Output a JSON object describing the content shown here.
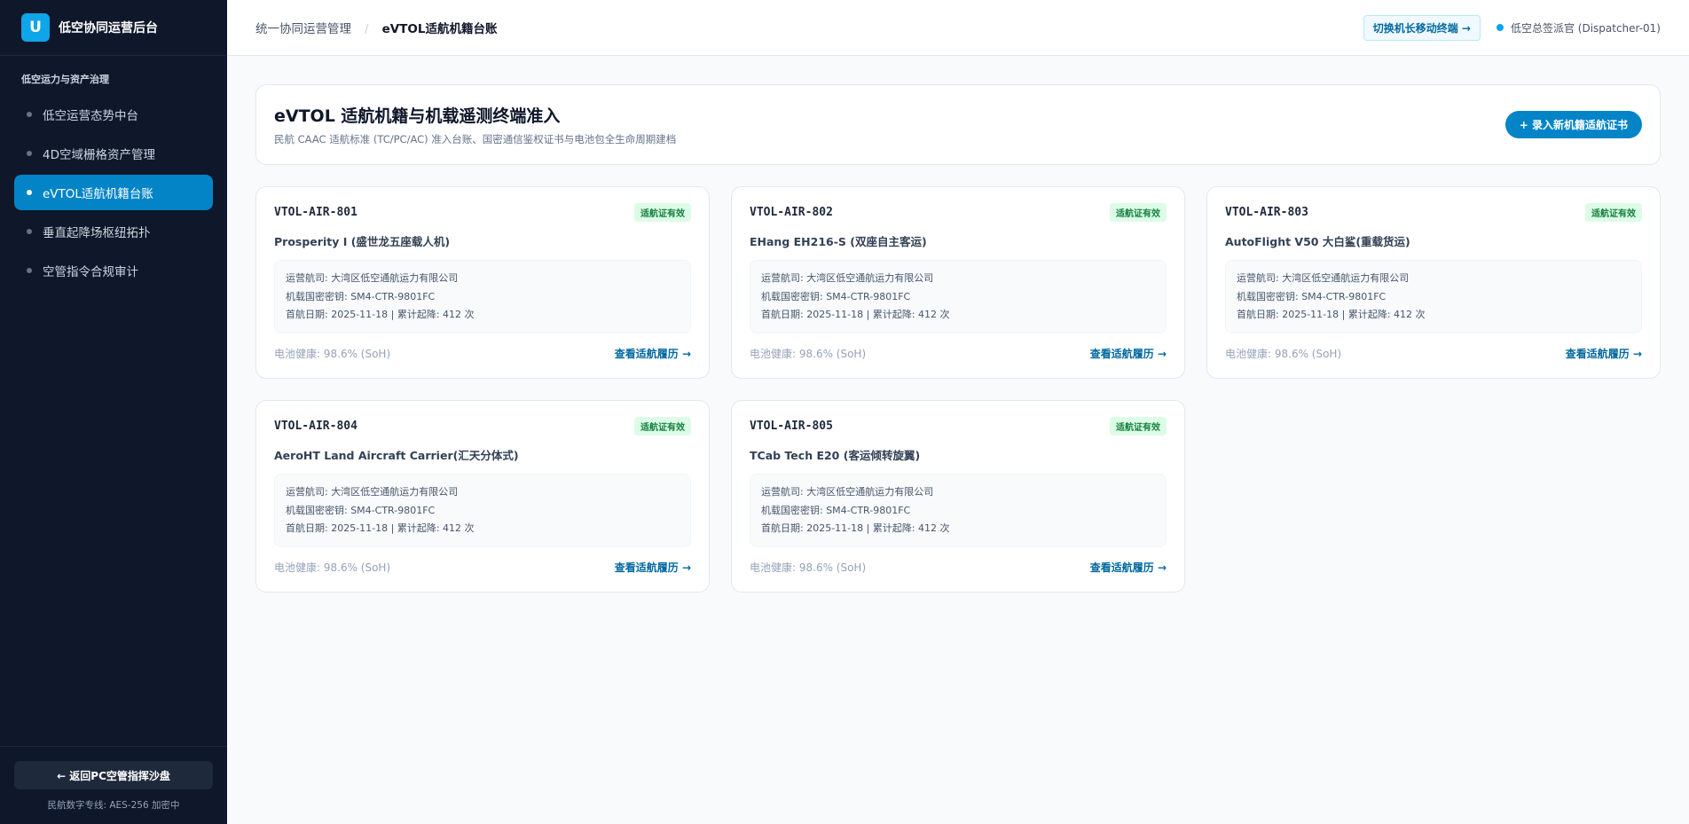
{
  "brand": {
    "logo_letter": "U",
    "title": "低空协同运营后台"
  },
  "sidebar": {
    "section_title": "低空运力与资产治理",
    "items": [
      {
        "label": "低空运营态势中台",
        "active": false
      },
      {
        "label": "4D空域栅格资产管理",
        "active": false
      },
      {
        "label": "eVTOL适航机籍台账",
        "active": true
      },
      {
        "label": "垂直起降场枢纽拓扑",
        "active": false
      },
      {
        "label": "空管指令合规审计",
        "active": false
      }
    ],
    "back_button": "← 返回PC空管指挥沙盘",
    "footer_note": "民航数字专线: AES-256 加密中"
  },
  "topbar": {
    "breadcrumb_parent": "统一协同运营管理",
    "breadcrumb_sep": "/",
    "breadcrumb_current": "eVTOL适航机籍台账",
    "switch_button": "切换机长移动终端 →",
    "user_label": "低空总签派官 (Dispatcher-01)"
  },
  "header": {
    "title": "eVTOL 适航机籍与机载遥测终端准入",
    "subtitle": "民航 CAAC 适航标准 (TC/PC/AC) 准入台账、国密通信鉴权证书与电池包全生命周期建档",
    "add_button": "+ 录入新机籍适航证书"
  },
  "cards": [
    {
      "id": "VTOL-AIR-801",
      "badge": "适航证有效",
      "model": "Prosperity I (盛世龙五座载人机)",
      "operator": "运营航司: 大湾区低空通航运力有限公司",
      "key": "机载国密密钥: SM4-CTR-9801FC",
      "first_flight": "首航日期: 2025-11-18 | 累计起降: 412 次",
      "battery": "电池健康: 98.6% (SoH)",
      "link": "查看适航履历 →"
    },
    {
      "id": "VTOL-AIR-802",
      "badge": "适航证有效",
      "model": "EHang EH216-S (双座自主客运)",
      "operator": "运营航司: 大湾区低空通航运力有限公司",
      "key": "机载国密密钥: SM4-CTR-9801FC",
      "first_flight": "首航日期: 2025-11-18 | 累计起降: 412 次",
      "battery": "电池健康: 98.6% (SoH)",
      "link": "查看适航履历 →"
    },
    {
      "id": "VTOL-AIR-803",
      "badge": "适航证有效",
      "model": "AutoFlight V50 大白鲨(重载货运)",
      "operator": "运营航司: 大湾区低空通航运力有限公司",
      "key": "机载国密密钥: SM4-CTR-9801FC",
      "first_flight": "首航日期: 2025-11-18 | 累计起降: 412 次",
      "battery": "电池健康: 98.6% (SoH)",
      "link": "查看适航履历 →"
    },
    {
      "id": "VTOL-AIR-804",
      "badge": "适航证有效",
      "model": "AeroHT Land Aircraft Carrier(汇天分体式)",
      "operator": "运营航司: 大湾区低空通航运力有限公司",
      "key": "机载国密密钥: SM4-CTR-9801FC",
      "first_flight": "首航日期: 2025-11-18 | 累计起降: 412 次",
      "battery": "电池健康: 98.6% (SoH)",
      "link": "查看适航履历 →"
    },
    {
      "id": "VTOL-AIR-805",
      "badge": "适航证有效",
      "model": "TCab Tech E20 (客运倾转旋翼)",
      "operator": "运营航司: 大湾区低空通航运力有限公司",
      "key": "机载国密密钥: SM4-CTR-9801FC",
      "first_flight": "首航日期: 2025-11-18 | 累计起降: 412 次",
      "battery": "电池健康: 98.6% (SoH)",
      "link": "查看适航履历 →"
    }
  ],
  "colors": {
    "sidebar_bg": "#0f172a",
    "accent": "#0284c7",
    "badge_bg": "#dcfce7",
    "badge_text": "#15803d"
  }
}
